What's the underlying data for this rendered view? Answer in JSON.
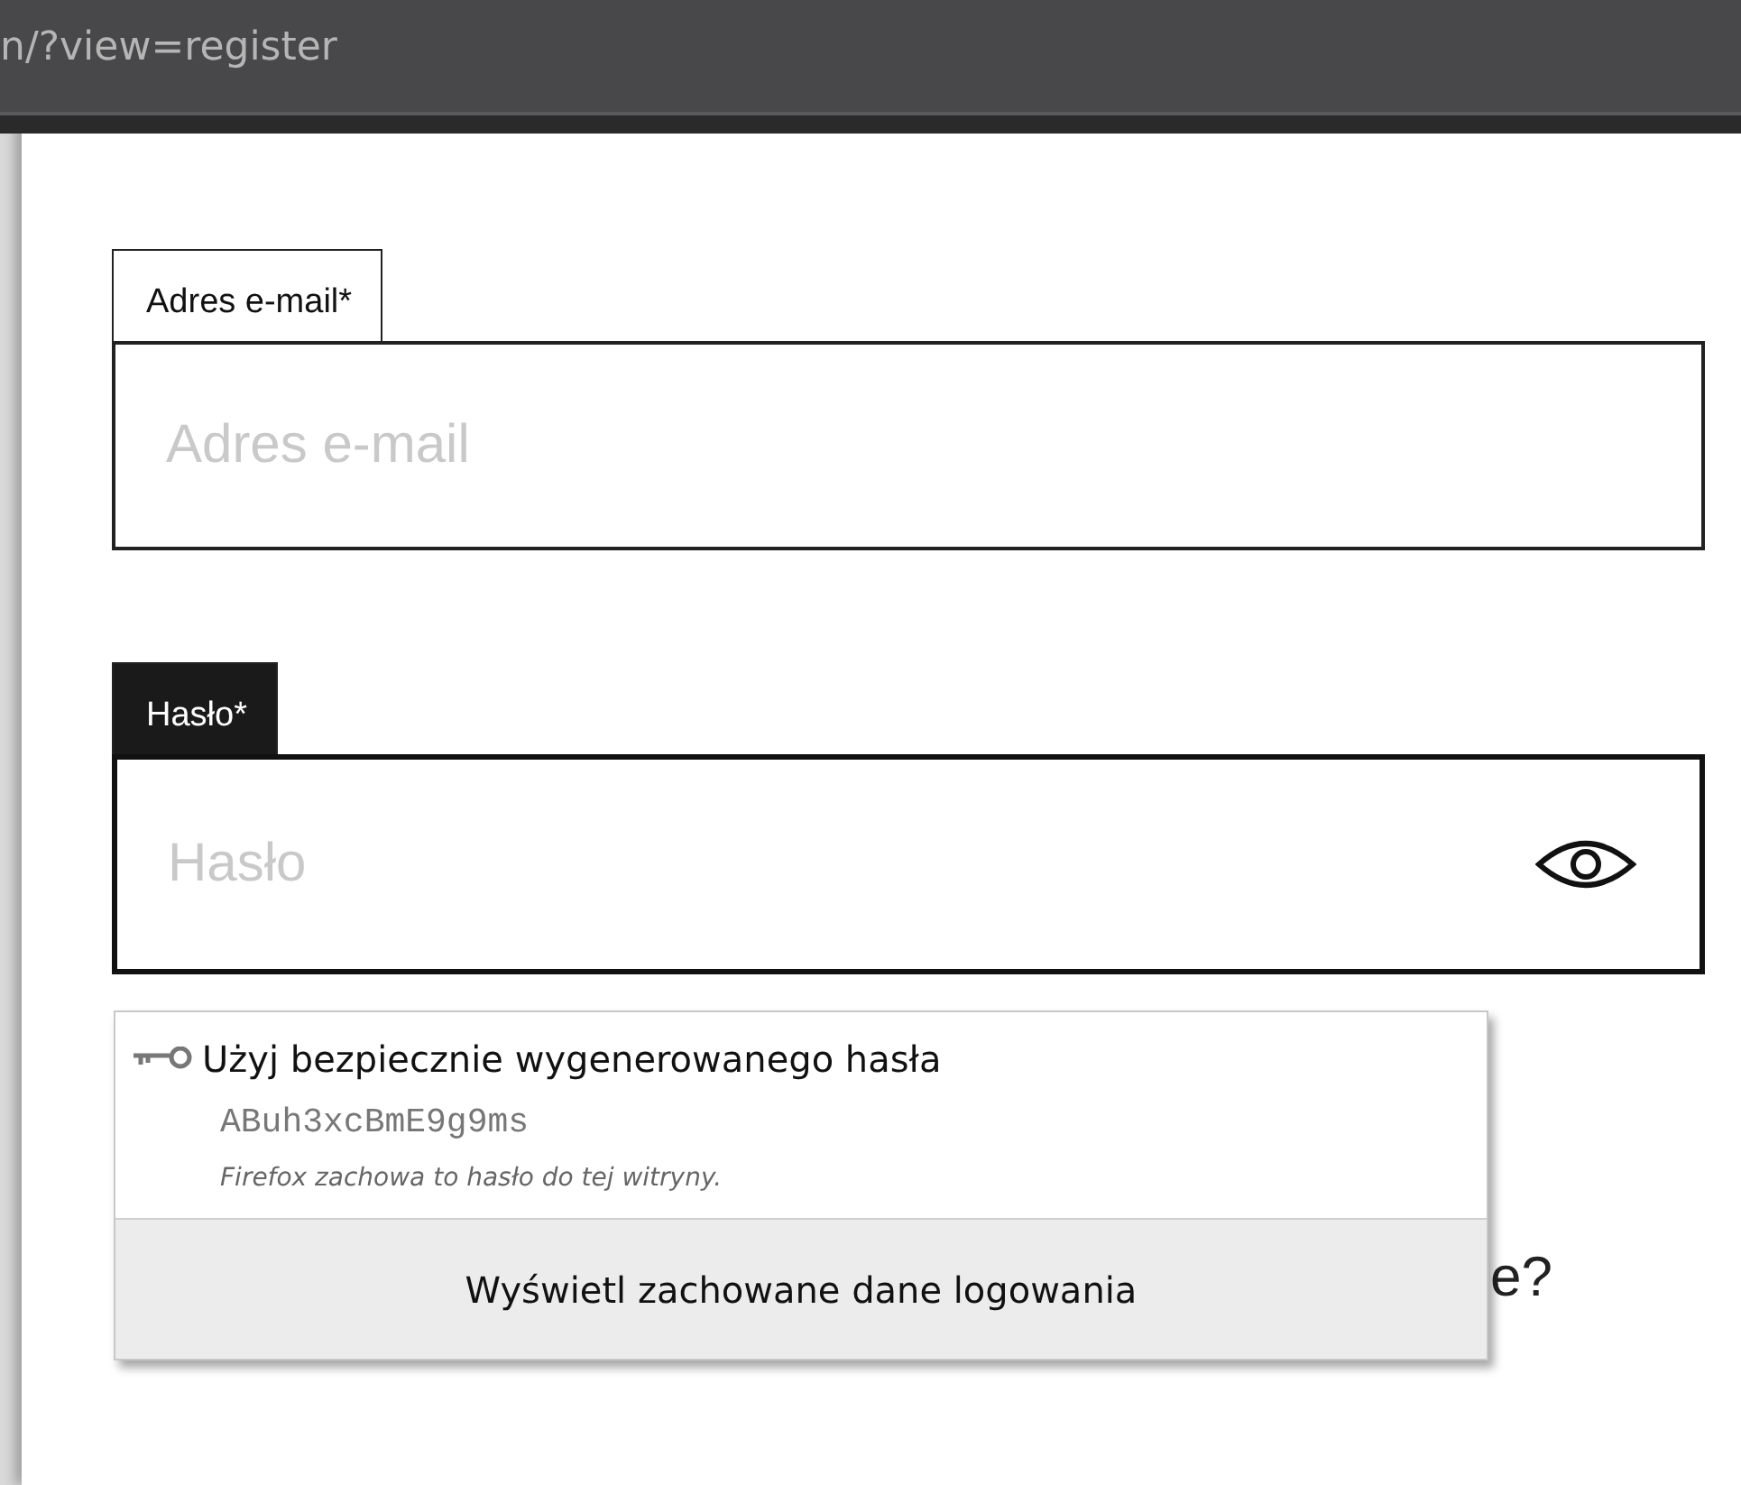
{
  "address_bar": {
    "url": "n/?view=register"
  },
  "fields": [
    {
      "label": "Adres e-mail*",
      "placeholder": "Adres e-mail",
      "focused": false,
      "reveal_icon": false
    },
    {
      "label": "Hasło*",
      "placeholder": "Hasło",
      "focused": true,
      "reveal_icon": true
    }
  ],
  "background_text": "e?",
  "password_popup": {
    "suggestion": "Użyj bezpiecznie wygenerowanego hasła",
    "generated_password": "ABuh3xcBmE9g9ms",
    "note": "Firefox zachowa to hasło do tej witryny.",
    "footer_button": "Wyświetl zachowane dane logowania"
  }
}
